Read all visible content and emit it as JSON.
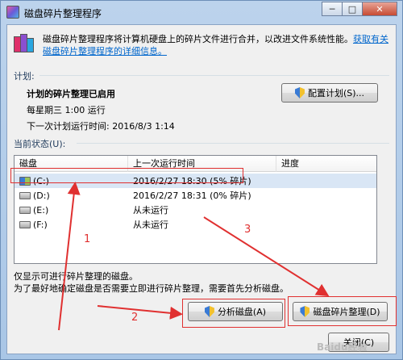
{
  "window": {
    "title": "磁盘碎片整理程序",
    "minimize": "─",
    "maximize": "□",
    "close": "✕"
  },
  "description": {
    "text": "磁盘碎片整理程序将计算机硬盘上的碎片文件进行合并，以改进文件系统性能。",
    "link": "获取有关磁盘碎片整理程序的详细信息。"
  },
  "schedule": {
    "section_label": "计划:",
    "status_title": "计划的碎片整理已启用",
    "run_time": "每星期三  1:00 运行",
    "next_run": "下一次计划运行时间: 2016/8/3 1:14",
    "configure_button": "配置计划(S)..."
  },
  "status": {
    "section_label": "当前状态(U):",
    "columns": [
      "磁盘",
      "上一次运行时间",
      "进度"
    ],
    "rows": [
      {
        "disk": "(C:)",
        "last_run": "2016/2/27 18:30 (5% 碎片)",
        "progress": ""
      },
      {
        "disk": "(D:)",
        "last_run": "2016/2/27 18:31 (0% 碎片)",
        "progress": ""
      },
      {
        "disk": "(E:)",
        "last_run": "从未运行",
        "progress": ""
      },
      {
        "disk": "(F:)",
        "last_run": "从未运行",
        "progress": ""
      }
    ]
  },
  "hints": {
    "line1": "仅显示可进行碎片整理的磁盘。",
    "line2": "为了最好地确定磁盘是否需要立即进行碎片整理，需要首先分析磁盘。"
  },
  "buttons": {
    "analyze": "分析磁盘(A)",
    "defrag": "磁盘碎片整理(D)",
    "close": "关闭(C)"
  },
  "annotations": {
    "n1": "1",
    "n2": "2",
    "n3": "3",
    "color": "#e03030"
  },
  "watermark": "Baidu经验"
}
